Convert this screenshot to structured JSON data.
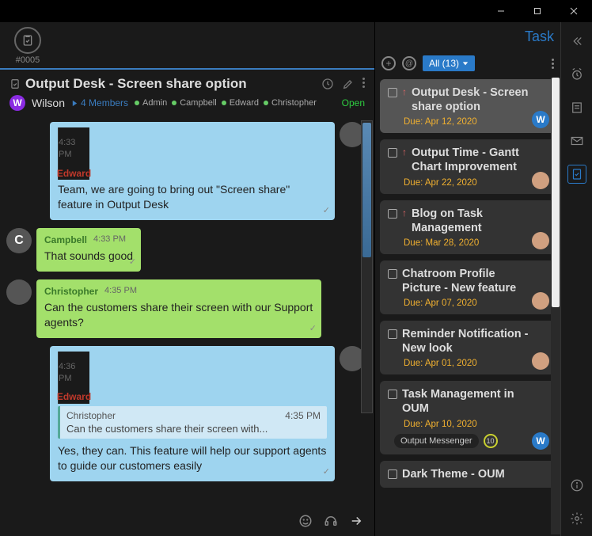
{
  "window": {
    "minimize": "−",
    "maximize": "□",
    "close": "✕"
  },
  "tab": {
    "id": "#0005"
  },
  "conv": {
    "title": "Output Desk - Screen share option",
    "owner_initial": "W",
    "owner_name": "Wilson",
    "members_count": "4 Members",
    "participants": [
      "Admin",
      "Campbell",
      "Edward",
      "Christopher"
    ],
    "status": "Open"
  },
  "messages": [
    {
      "side": "right",
      "author": "Edward",
      "author_color": "red",
      "time": "4:33 PM",
      "text": "Team, we are going to bring out \"Screen share\" feature in Output Desk",
      "avatar": "img"
    },
    {
      "side": "left",
      "author": "Campbell",
      "author_color": "green",
      "time": "4:33 PM",
      "text": "That sounds good",
      "avatar": "C"
    },
    {
      "side": "left",
      "author": "Christopher",
      "author_color": "green",
      "time": "4:35 PM",
      "text": "Can the customers share their screen with our Support agents?",
      "avatar": "img"
    },
    {
      "side": "right",
      "author": "Edward",
      "author_color": "red",
      "time": "4:36 PM",
      "quote": {
        "author": "Christopher",
        "time": "4:35 PM",
        "text": "Can the customers share their screen with..."
      },
      "text": "Yes, they can. This feature will help our support agents to guide our customers easily",
      "avatar": "img"
    }
  ],
  "panel": {
    "title": "Task",
    "filter": "All (13)",
    "tasks": [
      {
        "title": "Output Desk - Screen share option",
        "due": "Due: Apr 12, 2020",
        "priority": true,
        "selected": true,
        "avatar": "W"
      },
      {
        "title": "Output Time - Gantt Chart Improvement",
        "due": "Due: Apr 22, 2020",
        "priority": true,
        "avatar": "img"
      },
      {
        "title": "Blog on Task Management",
        "due": "Due: Mar 28, 2020",
        "priority": true,
        "avatar": "img"
      },
      {
        "title": "Chatroom Profile Picture - New feature",
        "due": "Due: Apr 07, 2020",
        "avatar": "img"
      },
      {
        "title": "Reminder Notification - New look",
        "due": "Due: Apr 01, 2020",
        "avatar": "img"
      },
      {
        "title": "Task Management in OUM",
        "due": "Due: Apr 10, 2020",
        "avatar": "W",
        "chip": "Output Messenger",
        "ring": "10"
      },
      {
        "title": "Dark Theme - OUM",
        "due": ""
      }
    ]
  }
}
